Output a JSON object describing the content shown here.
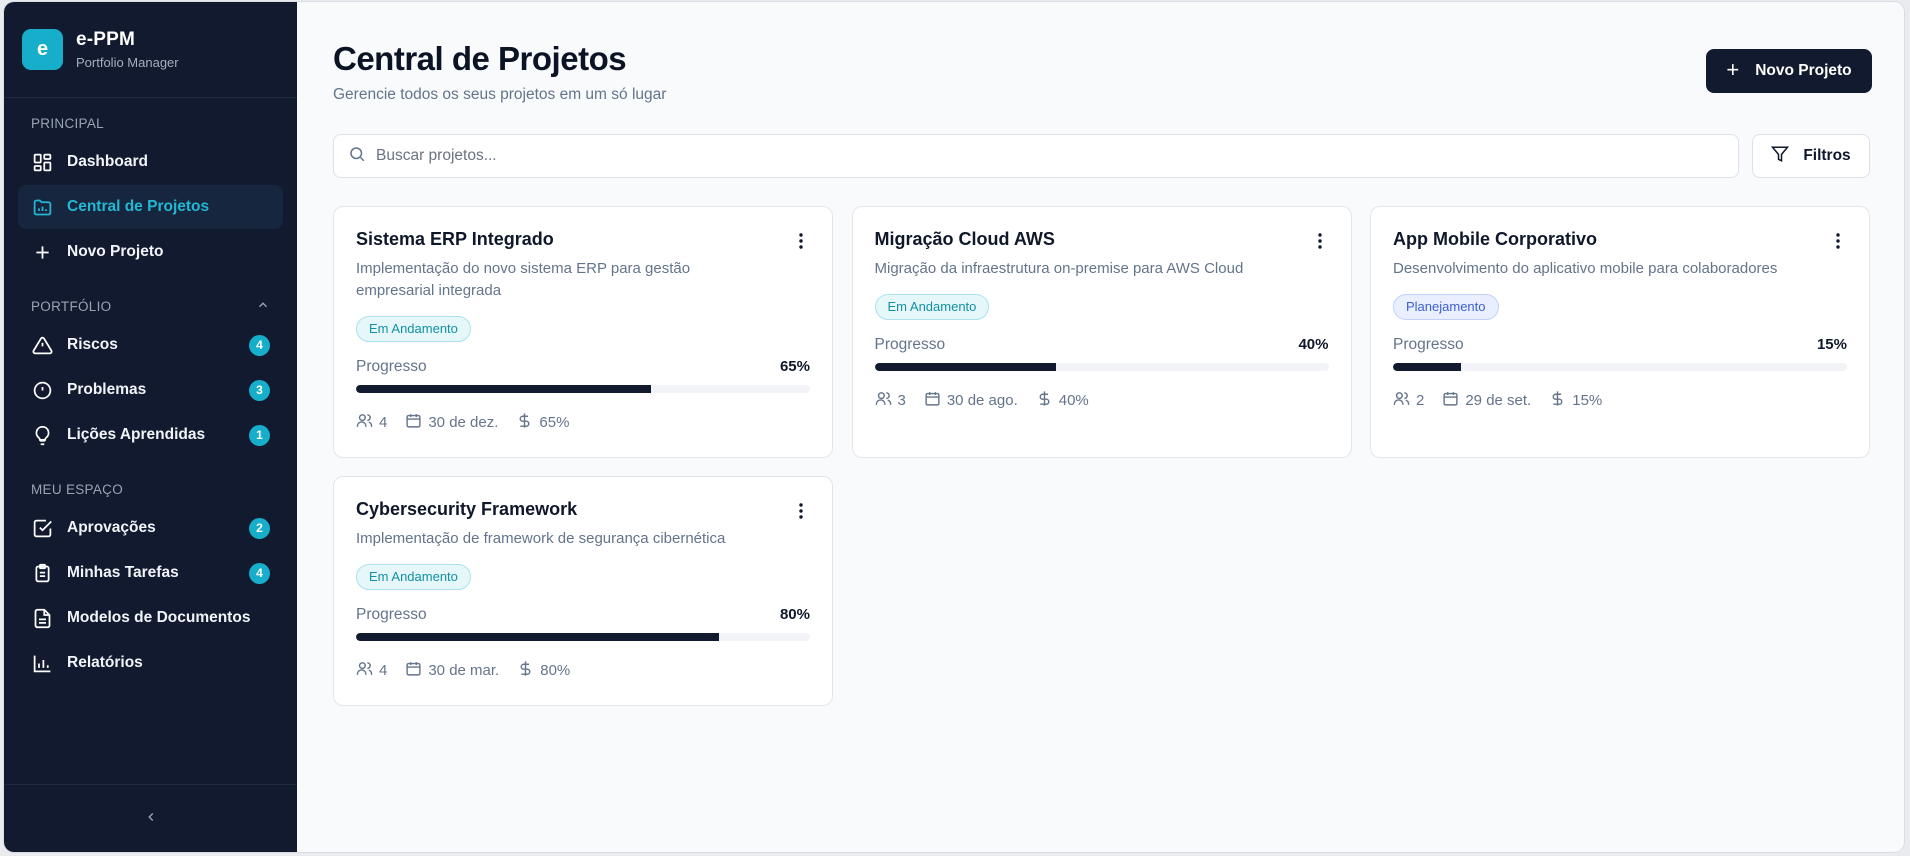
{
  "brand": {
    "logo_letter": "e",
    "name": "e-PPM",
    "subtitle": "Portfolio Manager",
    "accent": "#16aeca"
  },
  "sidebar": {
    "sections": [
      {
        "title": "PRINCIPAL",
        "items": [
          {
            "label": "Dashboard",
            "icon": "dashboard-icon"
          },
          {
            "label": "Central de Projetos",
            "icon": "folder-chart-icon",
            "active": true
          },
          {
            "label": "Novo Projeto",
            "icon": "plus-icon"
          }
        ]
      },
      {
        "title": "PORTFÓLIO",
        "collapsible": true,
        "items": [
          {
            "label": "Riscos",
            "icon": "warning-icon",
            "badge": "4"
          },
          {
            "label": "Problemas",
            "icon": "alert-circle-icon",
            "badge": "3"
          },
          {
            "label": "Lições Aprendidas",
            "icon": "lightbulb-icon",
            "badge": "1"
          }
        ]
      },
      {
        "title": "MEU ESPAÇO",
        "items": [
          {
            "label": "Aprovações",
            "icon": "check-square-icon",
            "badge": "2"
          },
          {
            "label": "Minhas Tarefas",
            "icon": "clipboard-icon",
            "badge": "4"
          },
          {
            "label": "Modelos de Documentos",
            "icon": "document-icon"
          },
          {
            "label": "Relatórios",
            "icon": "bar-chart-icon"
          }
        ]
      }
    ],
    "collapse_icon": "chevron-left-icon"
  },
  "header": {
    "title": "Central de Projetos",
    "subtitle": "Gerencie todos os seus projetos em um só lugar",
    "new_button": "Novo Projeto"
  },
  "search": {
    "placeholder": "Buscar projetos...",
    "value": ""
  },
  "filters_label": "Filtros",
  "progress_label": "Progresso",
  "projects": [
    {
      "title": "Sistema ERP Integrado",
      "description": "Implementação do novo sistema ERP para gestão empresarial integrada",
      "status": "Em Andamento",
      "status_kind": "run",
      "progress": 65,
      "progress_text": "65%",
      "members": "4",
      "date": "30 de dez.",
      "budget": "65%"
    },
    {
      "title": "Migração Cloud AWS",
      "description": "Migração da infraestrutura on-premise para AWS Cloud",
      "status": "Em Andamento",
      "status_kind": "run",
      "progress": 40,
      "progress_text": "40%",
      "members": "3",
      "date": "30 de ago.",
      "budget": "40%"
    },
    {
      "title": "App Mobile Corporativo",
      "description": "Desenvolvimento do aplicativo mobile para colaboradores",
      "status": "Planejamento",
      "status_kind": "plan",
      "progress": 15,
      "progress_text": "15%",
      "members": "2",
      "date": "29 de set.",
      "budget": "15%"
    },
    {
      "title": "Cybersecurity Framework",
      "description": "Implementação de framework de segurança cibernética",
      "status": "Em Andamento",
      "status_kind": "run",
      "progress": 80,
      "progress_text": "80%",
      "members": "4",
      "date": "30 de mar.",
      "budget": "80%"
    }
  ]
}
